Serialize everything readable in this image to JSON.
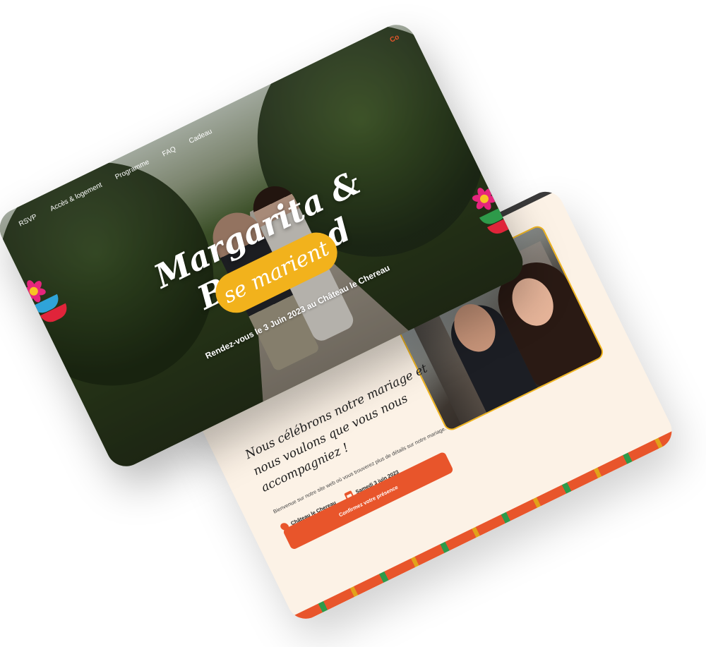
{
  "nav": {
    "items": [
      "RSVP",
      "Accès & logement",
      "Programme",
      "FAQ",
      "Cadeau"
    ],
    "cta": "Co"
  },
  "hero": {
    "names": "Margarita & Bertrand",
    "pill": "se marient",
    "tagline": "Rendez-vous le 3 Juin 2023 au Château le Chereau"
  },
  "intro": {
    "heading": "Nous célébrons notre mariage et nous voulons que vous nous accompagniez !",
    "description": "Bienvenue sur notre site web où vous trouverez plus de détails sur notre mariage.",
    "location": "Château le Chereau",
    "date": "Samedi 3 juin 2023",
    "confirm_label": "Confirmez votre présence"
  },
  "colors": {
    "accent_orange": "#e8552b",
    "accent_yellow": "#f2b21c",
    "cream": "#fcf2e6",
    "flower_pink": "#e6257d"
  },
  "icons": [
    "location-pin-icon",
    "calendar-icon",
    "flower-icon"
  ]
}
